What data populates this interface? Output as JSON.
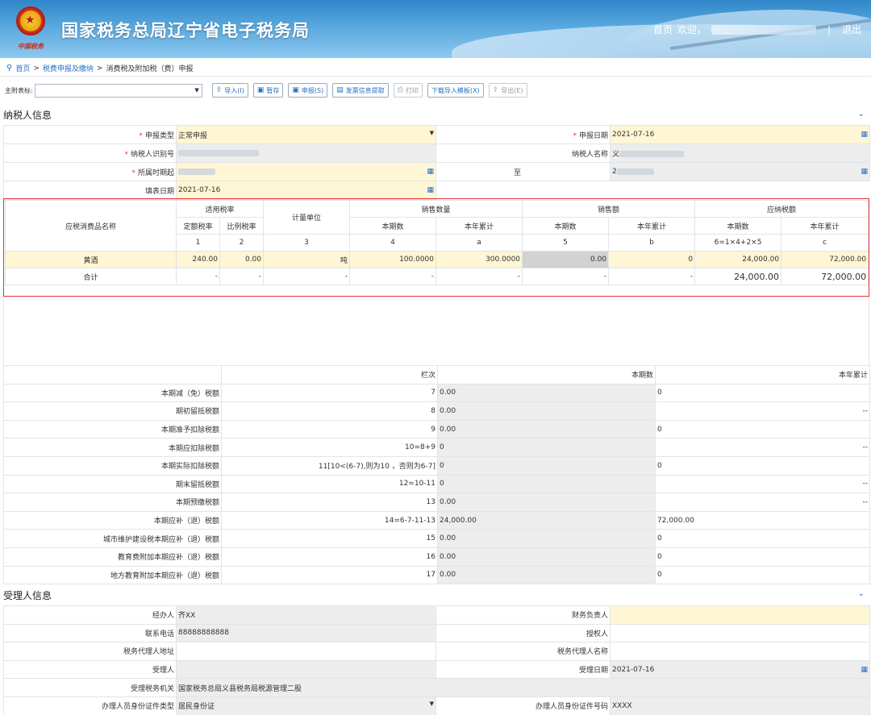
{
  "header": {
    "site_title": "国家税务总局辽宁省电子税务局",
    "emblem_caption": "中国税务",
    "nav_home": "首页",
    "nav_welcome": "欢迎，",
    "nav_separator": "|",
    "nav_logout": "退出"
  },
  "breadcrumb": {
    "home": "首页",
    "sep": ">",
    "level1": "税费申报及缴纳",
    "level2": "消费税及附加税（费）申报"
  },
  "toolbar": {
    "attachment_label": "主附表标:",
    "import_label": "导入(I)",
    "save_label": "暂存",
    "declare_label": "申报(S)",
    "invoice_label": "发票信息提取",
    "print_label": "打印",
    "template_label": "下载导入模板(X)",
    "export_label": "导出(E)"
  },
  "taxpayer": {
    "section_title": "纳税人信息",
    "declare_type_label": "申报类型",
    "declare_type_value": "正常申报",
    "declare_date_label": "申报日期",
    "declare_date_value": "2021-07-16",
    "taxpayer_id_label": "纳税人识别号",
    "taxpayer_name_label": "纳税人名称",
    "taxpayer_name_prefix": "义",
    "period_start_label": "所属时期起",
    "period_to_label": "至",
    "period_end_prefix": "2",
    "fill_date_label": "填表日期",
    "fill_date_value": "2021-07-16"
  },
  "goods_table": {
    "headers": {
      "item_name": "应税消费品名称",
      "rate": "适用税率",
      "fixed_rate": "定额税率",
      "prop_rate": "比例税率",
      "unit": "计量单位",
      "sales_qty": "销售数量",
      "sales_amt": "销售额",
      "tax_due": "应纳税额",
      "current": "本期数",
      "ytd": "本年累计"
    },
    "col_numbers": [
      "1",
      "2",
      "3",
      "4",
      "a",
      "5",
      "b",
      "6=1×4+2×5",
      "c"
    ],
    "row": {
      "name": "黄酒",
      "fixed_rate": "240.00",
      "prop_rate": "0.00",
      "unit": "吨",
      "qty_current": "100.0000",
      "qty_ytd": "300.0000",
      "amt_current": "0.00",
      "amt_ytd": "0",
      "tax_current": "24,000.00",
      "tax_ytd": "72,000.00"
    },
    "total": {
      "name": "合计",
      "dash": "-",
      "tax_current": "24,000.00",
      "tax_ytd": "72,000.00"
    }
  },
  "summary_table": {
    "col_line": "栏次",
    "col_current": "本期数",
    "col_ytd": "本年累计",
    "rows": [
      {
        "label": "本期减（免）税额",
        "line": "7",
        "current": "0.00",
        "ytd": "0"
      },
      {
        "label": "期初留抵税额",
        "line": "8",
        "current": "0.00",
        "ytd": "--"
      },
      {
        "label": "本期准予扣除税额",
        "line": "9",
        "current": "0.00",
        "ytd": "0"
      },
      {
        "label": "本期应扣除税额",
        "line": "10=8+9",
        "current": "0",
        "ytd": "--"
      },
      {
        "label": "本期实际扣除税额",
        "line": "11[10<(6-7),则为10 ，否则为6-7]",
        "current": "0",
        "ytd": "0"
      },
      {
        "label": "期末留抵税额",
        "line": "12=10-11",
        "current": "0",
        "ytd": "--"
      },
      {
        "label": "本期预缴税额",
        "line": "13",
        "current": "0.00",
        "ytd": "--"
      },
      {
        "label": "本期应补（退）税额",
        "line": "14=6-7-11-13",
        "current": "24,000.00",
        "ytd": "72,000.00"
      },
      {
        "label": "城市维护建设税本期应补（退）税额",
        "line": "15",
        "current": "0.00",
        "ytd": "0"
      },
      {
        "label": "教育费附加本期应补（退）税额",
        "line": "16",
        "current": "0.00",
        "ytd": "0"
      },
      {
        "label": "地方教育附加本期应补（退）税额",
        "line": "17",
        "current": "0.00",
        "ytd": "0"
      }
    ]
  },
  "acceptor": {
    "section_title": "受理人信息",
    "handler_label": "经办人",
    "handler_value": "齐XX",
    "finance_label": "财务负责人",
    "phone_label": "联系电话",
    "phone_value": "88888888888",
    "authorized_label": "授权人",
    "agent_addr_label": "税务代理人地址",
    "agent_name_label": "税务代理人名称",
    "receiver_label": "受理人",
    "receive_date_label": "受理日期",
    "receive_date_value": "2021-07-16",
    "receiving_office_label": "受理税务机关",
    "receiving_office_value": "国家税务总局义县税务局税源管理二股",
    "id_type_label": "办理人员身份证件类型",
    "id_type_value": "居民身份证",
    "id_no_label": "办理人员身份证件号码",
    "id_no_value": "XXXX"
  }
}
